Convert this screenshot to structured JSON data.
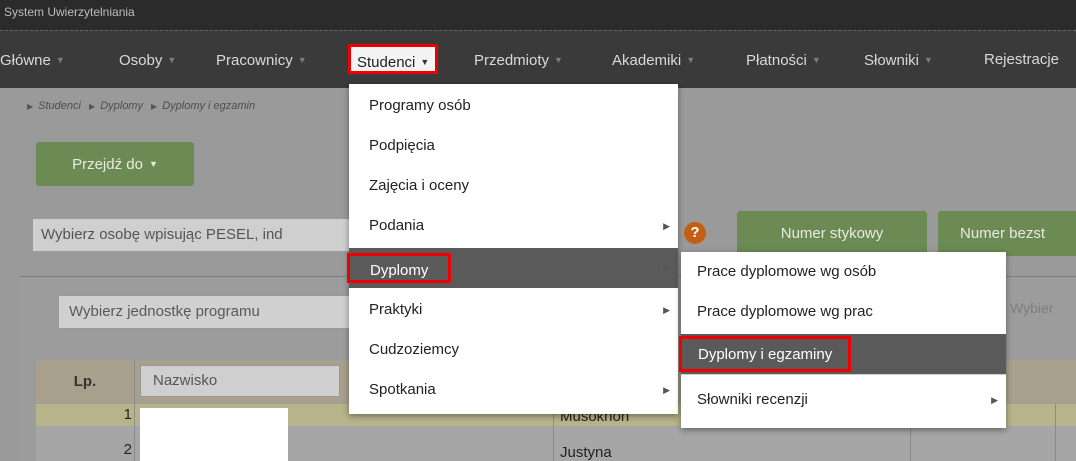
{
  "window": {
    "title": "System Uwierzytelniania"
  },
  "menubar": {
    "items": [
      "Główne",
      "Osoby",
      "Pracownicy",
      "Studenci",
      "Przedmioty",
      "Akademiki",
      "Płatności",
      "Słowniki",
      "Rejestracje"
    ]
  },
  "breadcrumb": [
    "Studenci",
    "Dyplomy",
    "Dyplomy i egzamin"
  ],
  "buttons": {
    "goto": "Przejdź do",
    "numer_stykowy": "Numer stykowy",
    "numer_bezst": "Numer bezst"
  },
  "search": {
    "pesel_placeholder": "Wybierz osobę wpisując PESEL, ind",
    "unit_placeholder": "Wybierz jednostkę programu",
    "wybier": "Wybier"
  },
  "help_icon": "?",
  "table": {
    "headers": {
      "lp": "Lp.",
      "name": "Nazwisko"
    },
    "rows": [
      {
        "lp": "1",
        "text": "Musokhon"
      },
      {
        "lp": "2",
        "text": "Justyna"
      }
    ]
  },
  "dropdown": {
    "items": [
      "Programy osób",
      "Podpięcia",
      "Zajęcia i oceny",
      "Podania",
      "Dyplomy",
      "Praktyki",
      "Cudzoziemcy",
      "Spotkania"
    ]
  },
  "submenu": {
    "items": [
      "Prace dyplomowe wg osób",
      "Prace dyplomowe wg prac",
      "Dyplomy i egzaminy",
      "Słowniki recenzji"
    ]
  },
  "colors": {
    "highlight_border": "#e00000",
    "menu_bg": "#3a3a3a",
    "accent_green": "#6b8a54",
    "help_orange": "#c25f14"
  }
}
